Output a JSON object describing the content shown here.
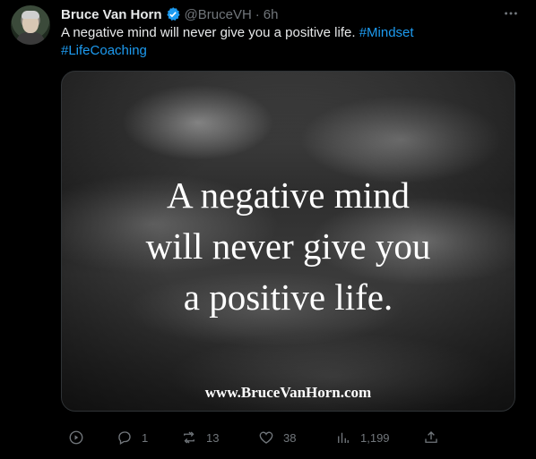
{
  "tweet": {
    "author_name": "Bruce Van Horn",
    "handle": "@BruceVH",
    "separator": "·",
    "time": "6h",
    "text_main": "A negative mind will never give you a positive life. ",
    "hashtag_1": "#Mindset",
    "hashtag_2": "#LifeCoaching",
    "more_icon": "more-horizontal-icon",
    "verified_icon": "verified-badge-icon"
  },
  "media": {
    "quote_line_1": "A negative mind",
    "quote_line_2": "will never give you",
    "quote_line_3": "a positive life.",
    "website": "www.BruceVanHorn.com"
  },
  "actions": {
    "video_icon": "play-circle-icon",
    "reply_count": "1",
    "retweet_count": "13",
    "like_count": "38",
    "views_count": "1,199",
    "share_icon": "share-icon"
  },
  "colors": {
    "background": "#000000",
    "text": "#e7e9ea",
    "muted": "#71767b",
    "accent": "#1d9bf0"
  }
}
